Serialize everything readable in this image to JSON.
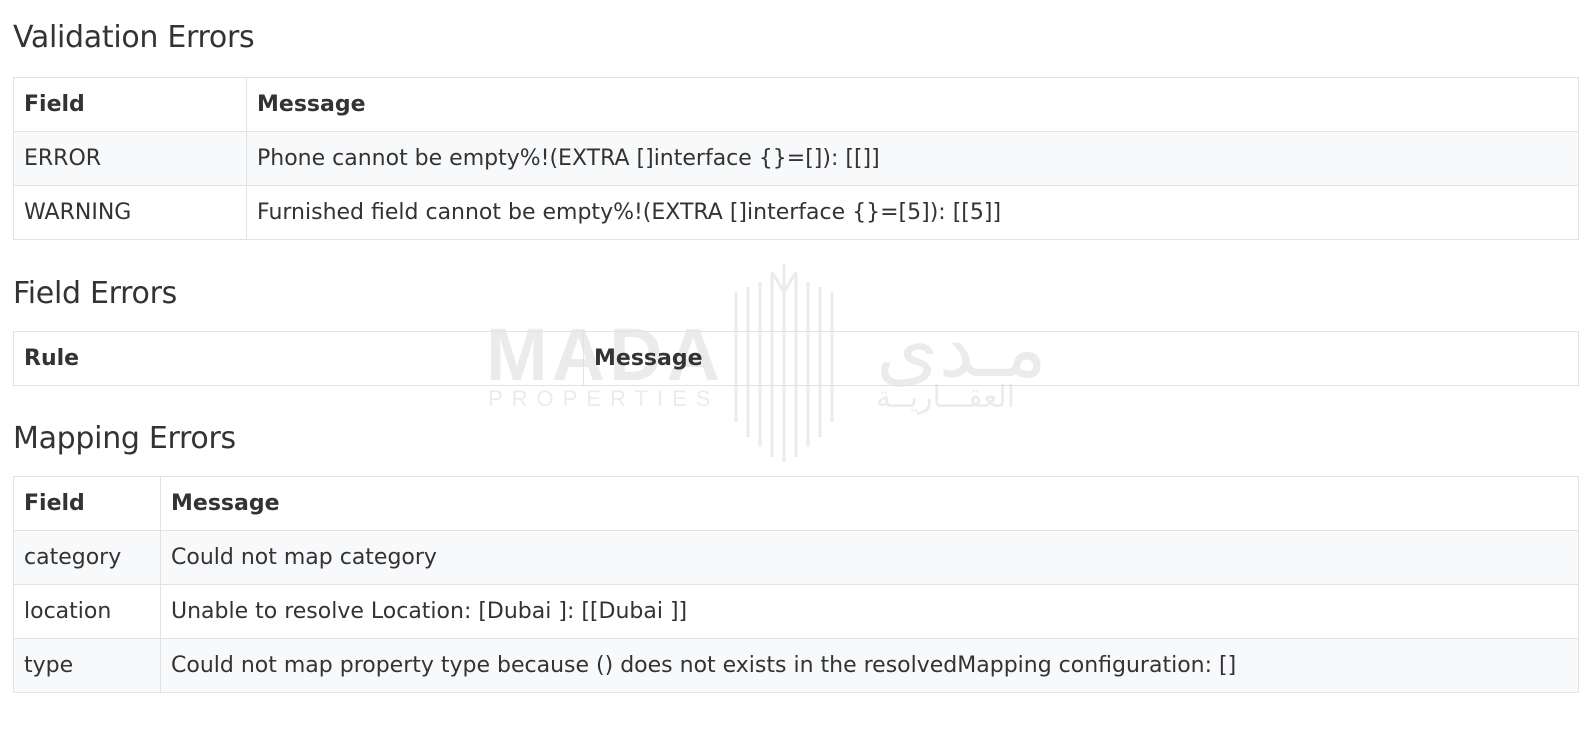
{
  "validation": {
    "title": "Validation Errors",
    "headers": [
      "Field",
      "Message"
    ],
    "rows": [
      [
        "ERROR",
        "Phone cannot be empty%!(EXTRA []interface {}=[]): [[]]"
      ],
      [
        "WARNING",
        "Furnished field cannot be empty%!(EXTRA []interface {}=[5]): [[5]]"
      ]
    ]
  },
  "field_errors": {
    "title": "Field Errors",
    "headers": [
      "Rule",
      "Message"
    ],
    "rows": []
  },
  "mapping": {
    "title": "Mapping Errors",
    "headers": [
      "Field",
      "Message"
    ],
    "rows": [
      [
        "category",
        "Could not map category"
      ],
      [
        "location",
        "Unable to resolve Location: [Dubai ]: [[Dubai ]]"
      ],
      [
        "type",
        "Could not map property type because () does not exists in the resolvedMapping configuration: []"
      ]
    ]
  },
  "watermark": {
    "latin": "MADA",
    "latin_sub": "PROPERTIES",
    "arabic": "مـدى",
    "arabic_sub": "العقـــاريــة",
    "icon": "mada-logo-icon"
  }
}
